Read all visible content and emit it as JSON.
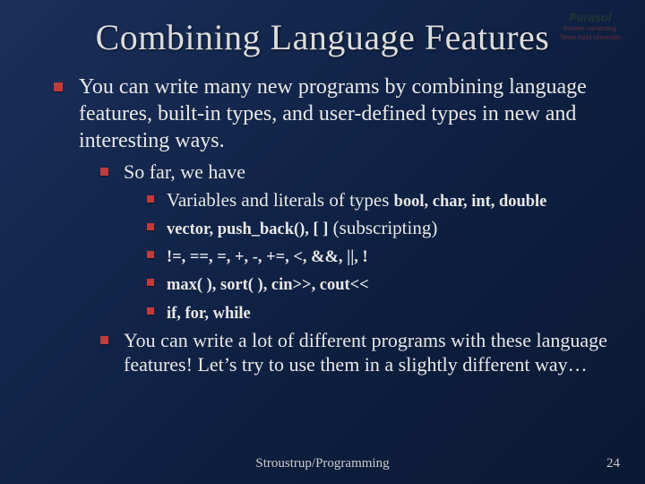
{
  "title": "Combining Language Features",
  "logo": {
    "name": "Parasol",
    "sub1": "Smarter computing.",
    "sub2": "Texas A&M University"
  },
  "body": {
    "p1": "You can write many new programs by combining language features, built-in types, and user-defined types in new and interesting ways.",
    "sofar_label": "So far, we have",
    "items": {
      "i1a": "Variables and literals of types ",
      "i1b": "bool, char, int, double",
      "i2a": "vector, push_back(), [ ]",
      "i2b": " (subscripting)",
      "i3": "!=, ==, =, +, -, +=, <, &&, ||, !",
      "i4": "max( ), sort( ), cin>>, cout<<",
      "i5": "if, for, while"
    },
    "p2": "You can write a lot of different programs with these language features! Let’s try to use them in a slightly different way…"
  },
  "footer": {
    "center": "Stroustrup/Programming",
    "page": "24"
  }
}
